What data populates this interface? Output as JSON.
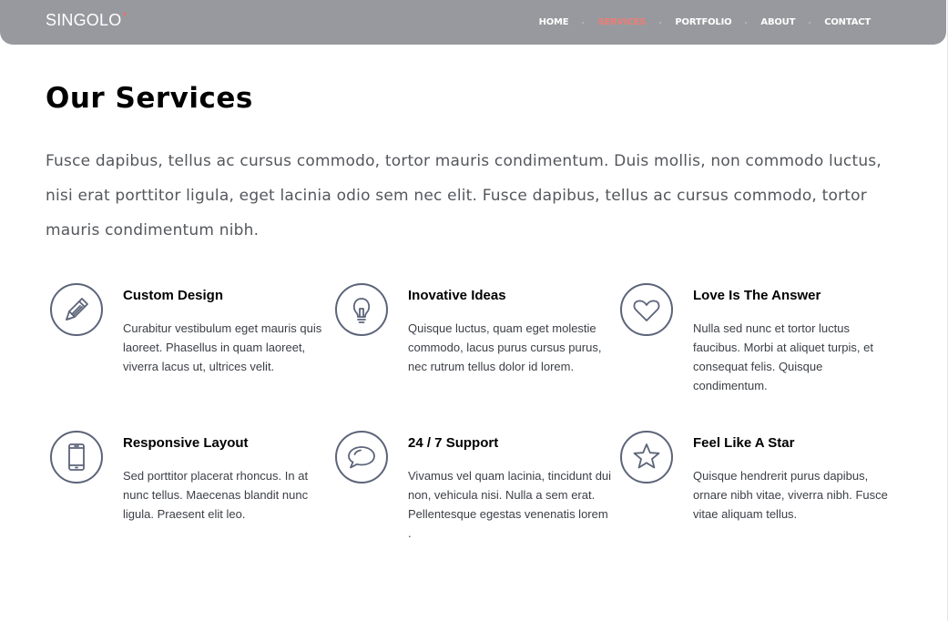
{
  "header": {
    "logo_text": "SINGOLO",
    "logo_mark": "*",
    "nav": [
      {
        "label": "HOME",
        "active": false
      },
      {
        "label": "SERVICES",
        "active": true
      },
      {
        "label": "PORTFOLIO",
        "active": false
      },
      {
        "label": "ABOUT",
        "active": false
      },
      {
        "label": "CONTACT",
        "active": false
      }
    ],
    "background_color": "#98999e",
    "active_color": "#f07c74"
  },
  "main": {
    "title": "Our Services",
    "intro": "Fusce dapibus, tellus ac cursus commodo, tortor mauris condimentum. Duis mollis, non commodo luctus, nisi erat porttitor ligula, eget lacinia odio sem nec elit. Fusce dapibus, tellus ac cursus commodo, tortor mauris condimentum nibh.",
    "services": [
      {
        "icon": "pencil-icon",
        "title": "Custom Design",
        "text": "Curabitur vestibulum eget mauris quis laoreet. Phasellus in quam laoreet, viverra lacus ut, ultrices velit."
      },
      {
        "icon": "lightbulb-icon",
        "title": "Inovative Ideas",
        "text": "Quisque luctus, quam eget molestie commodo, lacus purus cursus purus, nec rutrum tellus dolor id lorem."
      },
      {
        "icon": "heart-icon",
        "title": "Love Is The Answer",
        "text": "Nulla sed nunc et tortor luctus faucibus. Morbi at aliquet turpis, et consequat felis. Quisque condimentum."
      },
      {
        "icon": "smartphone-icon",
        "title": "Responsive Layout",
        "text": "Sed porttitor placerat rhoncus. In at nunc tellus. Maecenas blandit nunc ligula. Praesent elit leo."
      },
      {
        "icon": "chat-bubble-icon",
        "title": "24 / 7 Support",
        "text": "Vivamus vel quam lacinia, tincidunt dui non, vehicula nisi. Nulla a sem erat. Pellentesque egestas venenatis lorem ."
      },
      {
        "icon": "star-icon",
        "title": "Feel Like A Star",
        "text": "Quisque hendrerit purus dapibus, ornare nibh vitae, viverra nibh. Fusce vitae aliquam tellus."
      }
    ],
    "icon_color": "#5c6479"
  }
}
